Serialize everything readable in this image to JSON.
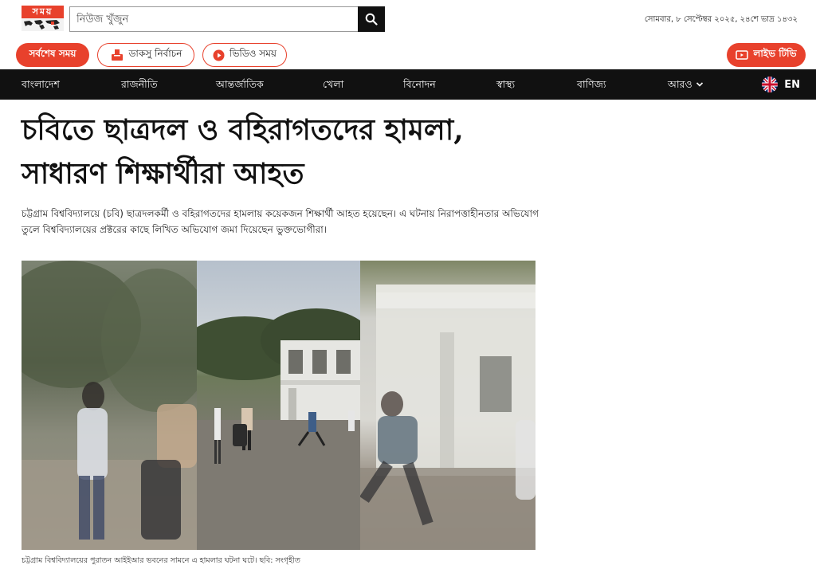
{
  "brand": {
    "logo_text": "সময়"
  },
  "search": {
    "placeholder": "নিউজ খুঁজুন"
  },
  "header": {
    "date": "সোমবার, ৮ সেপ্টেম্বর ২০২৫, ২৪শে ভাদ্র ১৪৩২"
  },
  "quick_links": {
    "latest": "সর্বশেষ সময়",
    "election": "ডাকসু নির্বাচন",
    "video": "ভিডিও সময়",
    "live_tv": "লাইভ টিভি"
  },
  "nav": {
    "items": [
      "বাংলাদেশ",
      "রাজনীতি",
      "আন্তর্জাতিক",
      "খেলা",
      "বিনোদন",
      "স্বাস্থ্য",
      "বাণিজ্য",
      "আরও"
    ],
    "lang": "EN"
  },
  "article": {
    "headline_line1": "চবিতে ছাত্রদল ও বহিরাগতদের হামলা,",
    "headline_line2": "সাধারণ শিক্ষার্থীরা আহত",
    "lead": "চট্টগ্রাম বিশ্ববিদ্যালয়ে (চবি) ছাত্রদলকর্মী ও বহিরাগতদের হামলায় কয়েকজন শিক্ষার্থী আহত হয়েছেন। এ ঘটনায় নিরাপত্তাহীনতার অভিযোগ তুলে বিশ্ববিদ্যালয়ের প্রক্টরের কাছে লিখিত অভিযোগ জমা দিয়েছেন ভুক্তভোগীরা।",
    "caption": "চট্টগ্রাম বিশ্ববিদ্যালয়ের পুরাতন আইইআর ভবনের সামনে এ হামলার ঘটনা ঘটে। ছবি: সংগৃহীত"
  },
  "icons": {
    "search": "search-icon",
    "ballot": "ballot-box-icon",
    "play": "play-circle-icon",
    "tv": "tv-icon",
    "chevron": "chevron-down-icon",
    "flag": "uk-flag-icon"
  },
  "colors": {
    "brand": "#e8412c",
    "nav_bg": "#111111"
  }
}
